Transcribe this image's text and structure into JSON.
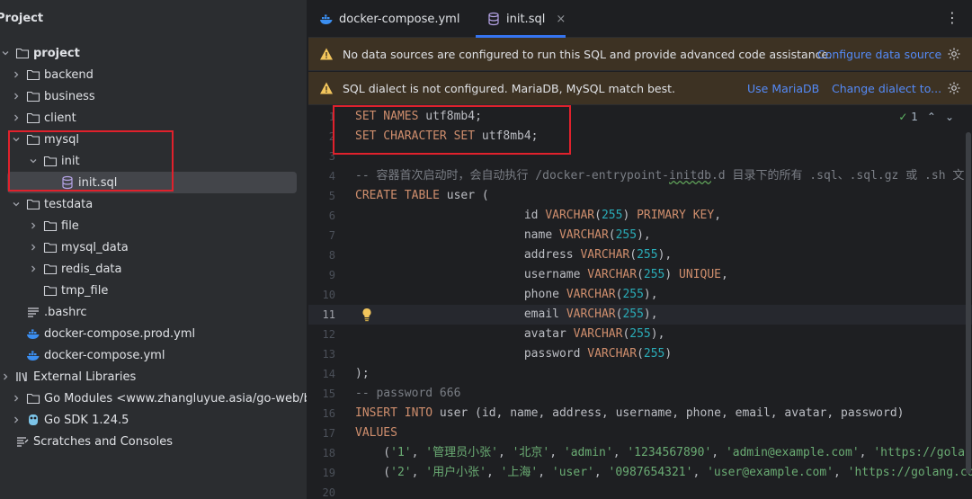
{
  "sidebar": {
    "title": "Project",
    "tree": [
      {
        "label": "project",
        "icon": "folder-icon",
        "arrow": "down",
        "bold": true
      },
      {
        "label": "backend",
        "icon": "folder-icon",
        "arrow": "right"
      },
      {
        "label": "business",
        "icon": "folder-icon",
        "arrow": "right"
      },
      {
        "label": "client",
        "icon": "folder-icon",
        "arrow": "right"
      },
      {
        "label": "mysql",
        "icon": "folder-icon",
        "arrow": "down"
      },
      {
        "label": "init",
        "icon": "folder-icon",
        "arrow": "down"
      },
      {
        "label": "init.sql",
        "icon": "sql-file-icon",
        "arrow": "none",
        "selected": true
      },
      {
        "label": "testdata",
        "icon": "folder-icon",
        "arrow": "down"
      },
      {
        "label": "file",
        "icon": "folder-icon",
        "arrow": "right"
      },
      {
        "label": "mysql_data",
        "icon": "folder-icon",
        "arrow": "right"
      },
      {
        "label": "redis_data",
        "icon": "folder-icon",
        "arrow": "right"
      },
      {
        "label": "tmp_file",
        "icon": "folder-icon",
        "arrow": "none"
      },
      {
        "label": ".bashrc",
        "icon": "text-file-icon",
        "arrow": "none"
      },
      {
        "label": "docker-compose.prod.yml",
        "icon": "docker-icon",
        "arrow": "none"
      },
      {
        "label": "docker-compose.yml",
        "icon": "docker-icon",
        "arrow": "none"
      },
      {
        "label": "External Libraries",
        "icon": "library-icon",
        "arrow": "right"
      },
      {
        "label": "Go Modules <www.zhangluyue.asia/go-web/business>",
        "icon": "folder-icon",
        "arrow": "right"
      },
      {
        "label": "Go SDK 1.24.5",
        "icon": "go-sdk-icon",
        "arrow": "right"
      },
      {
        "label": "Scratches and Consoles",
        "icon": "scratches-icon",
        "arrow": "none"
      }
    ]
  },
  "tabs": [
    {
      "label": "docker-compose.yml",
      "icon": "docker-icon",
      "active": false
    },
    {
      "label": "init.sql",
      "icon": "sql-file-icon",
      "active": true,
      "close": "×"
    }
  ],
  "more_menu": "⋮",
  "banners": [
    {
      "message": "No data sources are configured to run this SQL and provide advanced code assistance.",
      "links": [
        "Configure data source"
      ]
    },
    {
      "message": "SQL dialect is not configured. MariaDB, MySQL match best.",
      "links": [
        "Use MariaDB",
        "Change dialect to..."
      ]
    }
  ],
  "inspection": {
    "count": "1",
    "check": "✓"
  },
  "code_lines": [
    {
      "n": "1",
      "tokens": [
        [
          "kw",
          "SET NAMES "
        ],
        [
          "code",
          "utf8mb4;"
        ]
      ]
    },
    {
      "n": "2",
      "tokens": [
        [
          "kw",
          "SET CHARACTER SET "
        ],
        [
          "code",
          "utf8mb4;"
        ]
      ]
    },
    {
      "n": "3",
      "tokens": []
    },
    {
      "n": "4",
      "tokens": [
        [
          "cmt",
          "-- 容器首次启动时，会自动执行 /docker-entrypoint-"
        ],
        [
          "cmt-typo",
          "initdb"
        ],
        [
          "cmt",
          ".d 目录下的所有 .sql、.sql.gz 或 .sh 文"
        ]
      ]
    },
    {
      "n": "5",
      "tokens": [
        [
          "kw",
          "CREATE TABLE "
        ],
        [
          "code",
          "user ("
        ]
      ]
    },
    {
      "n": "6",
      "tokens": [
        [
          "code",
          "                        id "
        ],
        [
          "kw",
          "VARCHAR"
        ],
        [
          "code",
          "("
        ],
        [
          "num",
          "255"
        ],
        [
          "code",
          ") "
        ],
        [
          "kw",
          "PRIMARY KEY"
        ],
        [
          "code",
          ","
        ]
      ]
    },
    {
      "n": "7",
      "tokens": [
        [
          "code",
          "                        name "
        ],
        [
          "kw",
          "VARCHAR"
        ],
        [
          "code",
          "("
        ],
        [
          "num",
          "255"
        ],
        [
          "code",
          "),"
        ]
      ]
    },
    {
      "n": "8",
      "tokens": [
        [
          "code",
          "                        address "
        ],
        [
          "kw",
          "VARCHAR"
        ],
        [
          "code",
          "("
        ],
        [
          "num",
          "255"
        ],
        [
          "code",
          "),"
        ]
      ]
    },
    {
      "n": "9",
      "tokens": [
        [
          "code",
          "                        username "
        ],
        [
          "kw",
          "VARCHAR"
        ],
        [
          "code",
          "("
        ],
        [
          "num",
          "255"
        ],
        [
          "code",
          ") "
        ],
        [
          "kw",
          "UNIQUE"
        ],
        [
          "code",
          ","
        ]
      ]
    },
    {
      "n": "10",
      "tokens": [
        [
          "code",
          "                        phone "
        ],
        [
          "kw",
          "VARCHAR"
        ],
        [
          "code",
          "("
        ],
        [
          "num",
          "255"
        ],
        [
          "code",
          "),"
        ]
      ]
    },
    {
      "n": "11",
      "tokens": [
        [
          "code",
          "                        email "
        ],
        [
          "kw",
          "VARCHAR"
        ],
        [
          "code",
          "("
        ],
        [
          "num",
          "255"
        ],
        [
          "code",
          "),"
        ]
      ],
      "current": true
    },
    {
      "n": "12",
      "tokens": [
        [
          "code",
          "                        avatar "
        ],
        [
          "kw",
          "VARCHAR"
        ],
        [
          "code",
          "("
        ],
        [
          "num",
          "255"
        ],
        [
          "code",
          "),"
        ]
      ]
    },
    {
      "n": "13",
      "tokens": [
        [
          "code",
          "                        password "
        ],
        [
          "kw",
          "VARCHAR"
        ],
        [
          "code",
          "("
        ],
        [
          "num",
          "255"
        ],
        [
          "code",
          ")"
        ]
      ]
    },
    {
      "n": "14",
      "tokens": [
        [
          "code",
          ");"
        ]
      ]
    },
    {
      "n": "15",
      "tokens": [
        [
          "cmt",
          "-- password 666"
        ]
      ]
    },
    {
      "n": "16",
      "tokens": [
        [
          "kw",
          "INSERT INTO "
        ],
        [
          "code",
          "user (id, name, address, username, phone, email, avatar, password)"
        ]
      ]
    },
    {
      "n": "17",
      "tokens": [
        [
          "kw",
          "VALUES"
        ]
      ]
    },
    {
      "n": "18",
      "tokens": [
        [
          "code",
          "    ("
        ],
        [
          "str",
          "'1'"
        ],
        [
          "code",
          ", "
        ],
        [
          "str",
          "'管理员小张'"
        ],
        [
          "code",
          ", "
        ],
        [
          "str",
          "'北京'"
        ],
        [
          "code",
          ", "
        ],
        [
          "str",
          "'admin'"
        ],
        [
          "code",
          ", "
        ],
        [
          "str",
          "'1234567890'"
        ],
        [
          "code",
          ", "
        ],
        [
          "str",
          "'admin@example.com'"
        ],
        [
          "code",
          ", "
        ],
        [
          "str",
          "'https://golang.com"
        ]
      ]
    },
    {
      "n": "19",
      "tokens": [
        [
          "code",
          "    ("
        ],
        [
          "str",
          "'2'"
        ],
        [
          "code",
          ", "
        ],
        [
          "str",
          "'用户小张'"
        ],
        [
          "code",
          ", "
        ],
        [
          "str",
          "'上海'"
        ],
        [
          "code",
          ", "
        ],
        [
          "str",
          "'user'"
        ],
        [
          "code",
          ", "
        ],
        [
          "str",
          "'0987654321'"
        ],
        [
          "code",
          ", "
        ],
        [
          "str",
          "'user@example.com'"
        ],
        [
          "code",
          ", "
        ],
        [
          "str",
          "'https://golang.com"
        ]
      ]
    },
    {
      "n": "20",
      "tokens": []
    }
  ],
  "colors": {
    "accent": "#3574f0",
    "highlight_box": "#e0212c",
    "warning_banner": "#3d3223",
    "link": "#548af7"
  }
}
